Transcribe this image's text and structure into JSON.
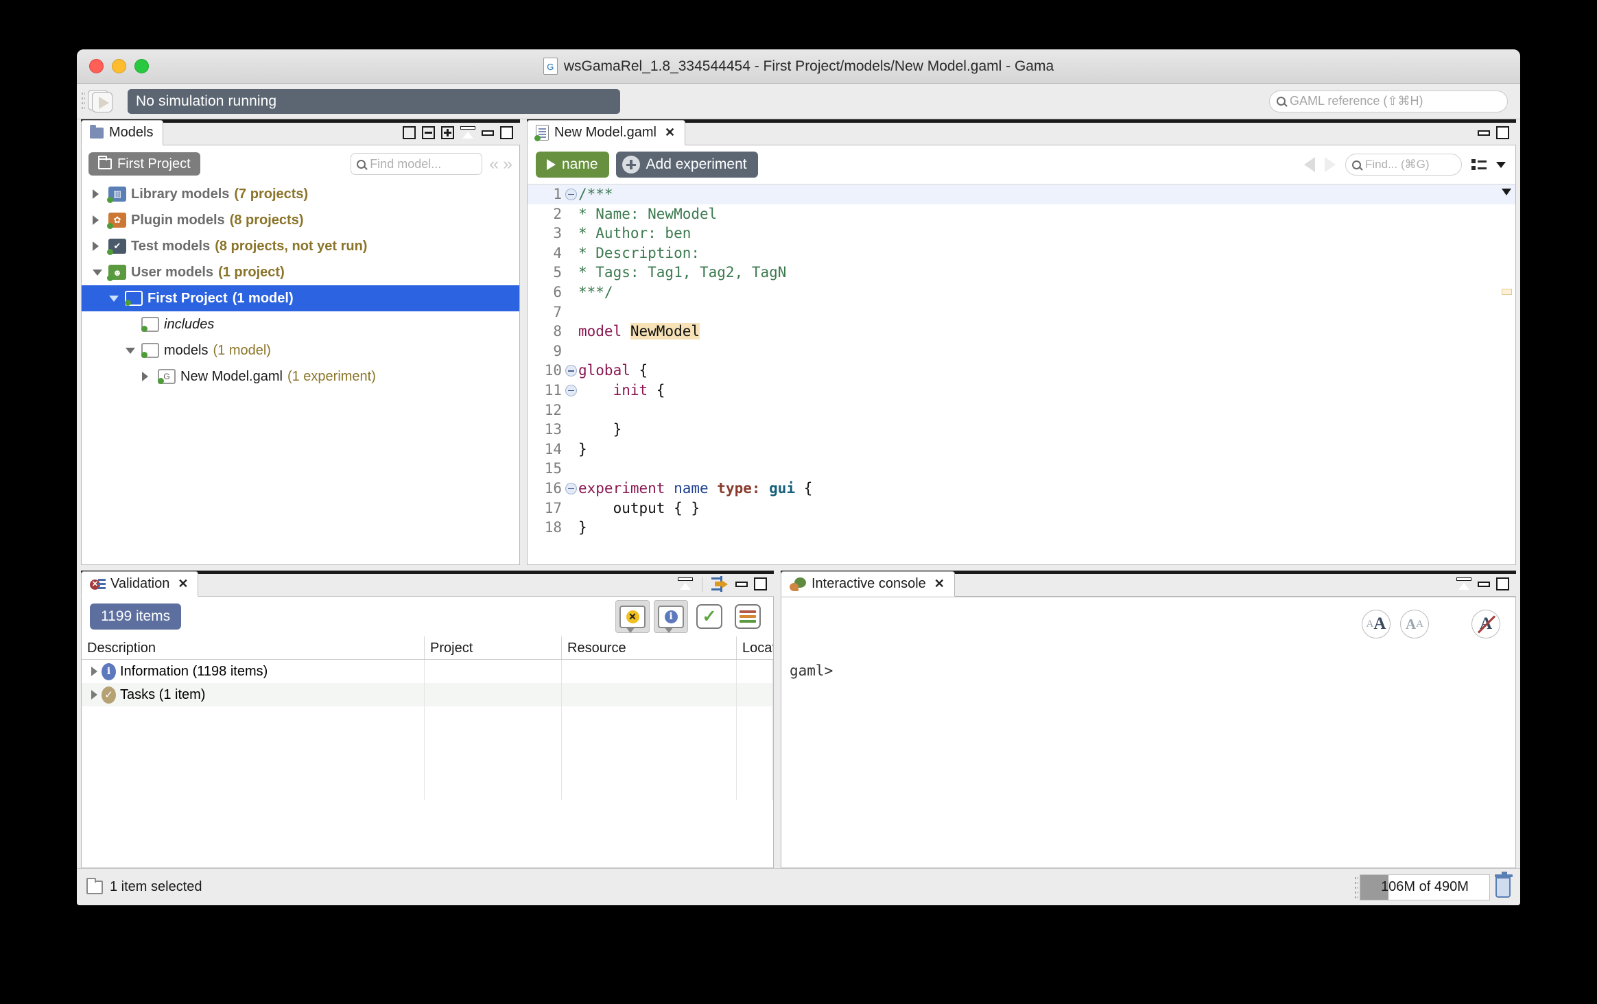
{
  "window": {
    "title": "wsGamaRel_1.8_334544454 - First Project/models/New Model.gaml - Gama",
    "title_icon": "gama-document-icon"
  },
  "toolbar": {
    "run_icon": "run-experiment-icon",
    "simulation_status": "No simulation running",
    "gaml_reference_placeholder": "GAML reference (⇧⌘H)"
  },
  "models_panel": {
    "tab_label": "Models",
    "toolbar_icons": [
      "history-icon",
      "collapse-all-icon",
      "expand-all-icon",
      "collapse-panel-icon",
      "minimize-icon",
      "maximize-icon"
    ],
    "project_chip": "First Project",
    "find_placeholder": "Find model...",
    "nav_prev": "«",
    "nav_next": "»",
    "tree": [
      {
        "label": "Library models",
        "count": "(7 projects)",
        "expanded": false,
        "indent": 0,
        "icon": "library-folder-icon",
        "icon_color": "#5a7fb5",
        "glyph": "▥",
        "style": "group"
      },
      {
        "label": "Plugin models",
        "count": "(8 projects)",
        "expanded": false,
        "indent": 0,
        "icon": "plugin-folder-icon",
        "icon_color": "#cc7733",
        "glyph": "✿",
        "style": "group"
      },
      {
        "label": "Test models",
        "count": "(8 projects, not yet run)",
        "expanded": false,
        "indent": 0,
        "icon": "test-folder-icon",
        "icon_color": "#4b5a6b",
        "glyph": "✔",
        "style": "group"
      },
      {
        "label": "User models",
        "count": "(1 project)",
        "expanded": true,
        "indent": 0,
        "icon": "user-folder-icon",
        "icon_color": "#5b9a3e",
        "glyph": "☻",
        "style": "group"
      },
      {
        "label": "First Project",
        "count": "(1 model)",
        "expanded": true,
        "indent": 1,
        "icon": "project-folder-icon",
        "icon_color": "#ffffff",
        "glyph": "",
        "style": "selected",
        "selected": true
      },
      {
        "label": "includes",
        "count": "",
        "expanded": null,
        "indent": 2,
        "icon": "includes-folder-icon",
        "icon_color": "#ffffff",
        "glyph": "",
        "style": "italic"
      },
      {
        "label": "models",
        "count": "(1 model)",
        "expanded": true,
        "indent": 2,
        "icon": "models-folder-icon",
        "icon_color": "#ffffff",
        "glyph": "",
        "style": "plain"
      },
      {
        "label": "New Model.gaml",
        "count": "(1 experiment)",
        "expanded": false,
        "indent": 3,
        "icon": "gaml-file-icon",
        "icon_color": "#ffffff",
        "glyph": "G",
        "style": "plain"
      }
    ]
  },
  "editor_panel": {
    "tab_label": "New Model.gaml",
    "tab_close": "✕",
    "run_button_label": "name",
    "add_experiment_label": "Add experiment",
    "find_placeholder": "Find... (⌘G)",
    "back_icon": "back-arrow-icon",
    "forward_icon": "forward-arrow-icon",
    "outline_icon": "outline-list-icon",
    "menu_caret": "▾",
    "code_lines": [
      {
        "n": 1,
        "fold": true,
        "highlight": true,
        "tokens": [
          {
            "t": "/***",
            "c": "c-com"
          }
        ]
      },
      {
        "n": 2,
        "fold": false,
        "highlight": false,
        "tokens": [
          {
            "t": "* Name: NewModel",
            "c": "c-com"
          }
        ]
      },
      {
        "n": 3,
        "fold": false,
        "highlight": false,
        "tokens": [
          {
            "t": "* Author: ben",
            "c": "c-com"
          }
        ]
      },
      {
        "n": 4,
        "fold": false,
        "highlight": false,
        "tokens": [
          {
            "t": "* Description: ",
            "c": "c-com"
          }
        ]
      },
      {
        "n": 5,
        "fold": false,
        "highlight": false,
        "tokens": [
          {
            "t": "* Tags: Tag1, Tag2, TagN",
            "c": "c-com"
          }
        ]
      },
      {
        "n": 6,
        "fold": false,
        "highlight": false,
        "tokens": [
          {
            "t": "***/",
            "c": "c-com"
          }
        ]
      },
      {
        "n": 7,
        "fold": false,
        "highlight": false,
        "tokens": []
      },
      {
        "n": 8,
        "fold": false,
        "highlight": false,
        "tokens": [
          {
            "t": "model ",
            "c": "c-kw"
          },
          {
            "t": "NewModel",
            "c": "c-hl"
          }
        ]
      },
      {
        "n": 9,
        "fold": false,
        "highlight": false,
        "tokens": []
      },
      {
        "n": 10,
        "fold": true,
        "highlight": false,
        "tokens": [
          {
            "t": "global ",
            "c": "c-kw"
          },
          {
            "t": "{",
            "c": "c-pl"
          }
        ]
      },
      {
        "n": 11,
        "fold": true,
        "highlight": false,
        "tokens": [
          {
            "t": "    init ",
            "c": "c-kw"
          },
          {
            "t": "{",
            "c": "c-pl"
          }
        ]
      },
      {
        "n": 12,
        "fold": false,
        "highlight": false,
        "tokens": [
          {
            "t": "\t",
            "c": "c-pl"
          }
        ]
      },
      {
        "n": 13,
        "fold": false,
        "highlight": false,
        "tokens": [
          {
            "t": "    }",
            "c": "c-pl"
          }
        ]
      },
      {
        "n": 14,
        "fold": false,
        "highlight": false,
        "tokens": [
          {
            "t": "}",
            "c": "c-pl"
          }
        ]
      },
      {
        "n": 15,
        "fold": false,
        "highlight": false,
        "tokens": []
      },
      {
        "n": 16,
        "fold": true,
        "highlight": false,
        "tokens": [
          {
            "t": "experiment ",
            "c": "c-kw"
          },
          {
            "t": "name ",
            "c": "c-fac"
          },
          {
            "t": "type: ",
            "c": "c-fac2"
          },
          {
            "t": "gui ",
            "c": "c-val"
          },
          {
            "t": "{",
            "c": "c-pl"
          }
        ]
      },
      {
        "n": 17,
        "fold": false,
        "highlight": false,
        "tokens": [
          {
            "t": "    output { }",
            "c": "c-pl"
          }
        ]
      },
      {
        "n": 18,
        "fold": false,
        "highlight": false,
        "tokens": [
          {
            "t": "}",
            "c": "c-pl"
          }
        ]
      }
    ]
  },
  "validation_panel": {
    "tab_label": "Validation",
    "tab_close": "✕",
    "items_badge": "1199 items",
    "toolbar_icons": [
      "show-errors-icon",
      "show-infos-icon",
      "validate-icon",
      "filters-icon"
    ],
    "panel_icons": [
      "collapse-panel-icon",
      "link-editor-icon",
      "minimize-icon",
      "maximize-icon"
    ],
    "columns": [
      "Description",
      "Project",
      "Resource",
      "Location"
    ],
    "sort_caret": "⌃",
    "rows": [
      {
        "description": "Information (1198 items)",
        "badge": "i",
        "badge_type": "info",
        "project": "",
        "resource": "",
        "location": ""
      },
      {
        "description": "Tasks (1 item)",
        "badge": "✓",
        "badge_type": "task",
        "project": "",
        "resource": "",
        "location": ""
      }
    ]
  },
  "console_panel": {
    "tab_label": "Interactive console",
    "tab_close": "✕",
    "panel_icons": [
      "collapse-panel-icon",
      "minimize-icon",
      "maximize-icon"
    ],
    "font_bigger_icon": "increase-font-icon",
    "font_smaller_icon": "decrease-font-icon",
    "font_reset_icon": "reset-font-icon",
    "prompt": "gaml>"
  },
  "statusbar": {
    "selection_text": "1 item selected",
    "memory_text": "106M of 490M",
    "trash_icon": "garbage-collect-icon"
  },
  "colors": {
    "accent_blue": "#2c63e0",
    "run_green": "#67913f",
    "slate": "#5c6672",
    "badge_blue": "#5d6f9e",
    "highlight_yellow": "#f6e2b6"
  }
}
